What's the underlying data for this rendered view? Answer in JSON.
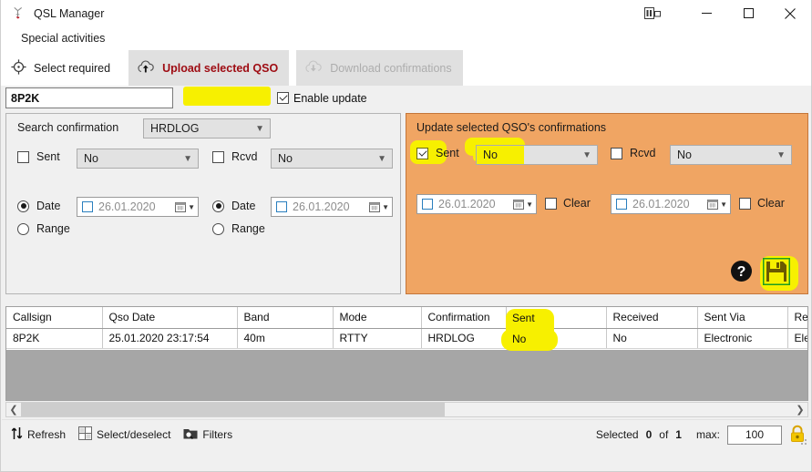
{
  "window": {
    "title": "QSL Manager",
    "app_icon": "antenna-icon",
    "controls": {
      "snap": "layout-snap-icon",
      "minimize": "minimize-icon",
      "maximize": "maximize-icon",
      "close": "close-icon"
    }
  },
  "menubar": {
    "items": [
      {
        "label": "Special activities"
      }
    ]
  },
  "toolbar": {
    "buttons": [
      {
        "label": "Select required",
        "icon": "target-icon",
        "state": "normal"
      },
      {
        "label": "Upload selected QSO",
        "icon": "cloud-upload-icon",
        "state": "active"
      },
      {
        "label": "Download confirmations",
        "icon": "cloud-download-icon",
        "state": "disabled"
      }
    ]
  },
  "callsign_row": {
    "callsign_value": "8P2K",
    "callsign_placeholder": "Callsign",
    "enable_update_label": "Enable update",
    "enable_update_checked": true
  },
  "search_panel": {
    "title": "Search confirmation",
    "source_value": "HRDLOG",
    "sent": {
      "label": "Sent",
      "checked": false,
      "value": "No"
    },
    "rcvd": {
      "label": "Rcvd",
      "checked": false,
      "value": "No"
    },
    "left_date": {
      "date_radio_label": "Date",
      "range_radio_label": "Range",
      "selected": "Date",
      "date_value": "26.01.2020",
      "date_checked": false
    },
    "right_date": {
      "date_radio_label": "Date",
      "range_radio_label": "Range",
      "selected": "Date",
      "date_value": "26.01.2020",
      "date_checked": false
    }
  },
  "update_panel": {
    "title": "Update selected QSO's confirmations",
    "accent_color": "#f0a563",
    "sent": {
      "label": "Sent",
      "checked": true,
      "value": "No"
    },
    "rcvd": {
      "label": "Rcvd",
      "checked": false,
      "value": "No"
    },
    "left_date": {
      "date_value": "26.01.2020",
      "date_checked": false,
      "clear_label": "Clear",
      "clear_checked": false
    },
    "right_date": {
      "date_value": "26.01.2020",
      "date_checked": false,
      "clear_label": "Clear",
      "clear_checked": false
    },
    "help_icon": "help-icon",
    "save_icon": "save-floppy-icon"
  },
  "table": {
    "columns": [
      "Callsign",
      "Qso Date",
      "Band",
      "Mode",
      "Confirmation",
      "Sent",
      "Received",
      "Sent Via",
      "Recei"
    ],
    "rows": [
      {
        "callsign": "8P2K",
        "qso_date": "25.01.2020 23:17:54",
        "band": "40m",
        "mode": "RTTY",
        "confirmation": "HRDLOG",
        "sent": "No",
        "received": "No",
        "sent_via": "Electronic",
        "received_via": "Electro"
      }
    ]
  },
  "scrollbar": {
    "left_arrow": "chevron-left-icon",
    "right_arrow": "chevron-right-icon"
  },
  "statusbar": {
    "refresh_label": "Refresh",
    "select_deselect_label": "Select/deselect",
    "filters_label": "Filters",
    "selected_prefix": "Selected",
    "selected_count": "0",
    "of_label": "of",
    "total_count": "1",
    "max_label": "max:",
    "max_value": "100",
    "lock_icon": "lock-icon"
  },
  "highlights": {
    "color": "#f7f000",
    "items": [
      "enable-update",
      "update-sent-checkbox",
      "update-sent-value",
      "save-button",
      "table-sent-column"
    ]
  }
}
